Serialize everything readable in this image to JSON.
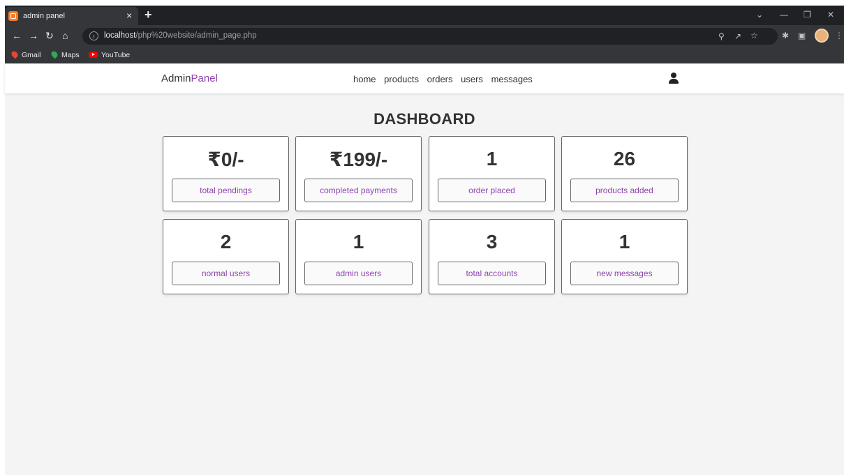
{
  "browser": {
    "tab_title": "admin panel",
    "tab_close": "×",
    "new_tab": "+",
    "url_host": "localhost",
    "url_path": "/php%20website/admin_page.php",
    "bookmarks": [
      "Gmail",
      "Maps",
      "YouTube"
    ]
  },
  "header": {
    "logo_main": "Admin",
    "logo_accent": "Panel",
    "nav": [
      "home",
      "products",
      "orders",
      "users",
      "messages"
    ],
    "user_icon": "user-icon"
  },
  "dashboard": {
    "title": "DASHBOARD",
    "cards": [
      {
        "value": "₹0/-",
        "label": "total pendings"
      },
      {
        "value": "₹199/-",
        "label": "completed payments"
      },
      {
        "value": "1",
        "label": "order placed"
      },
      {
        "value": "26",
        "label": "products added"
      },
      {
        "value": "2",
        "label": "normal users"
      },
      {
        "value": "1",
        "label": "admin users"
      },
      {
        "value": "3",
        "label": "total accounts"
      },
      {
        "value": "1",
        "label": "new messages"
      }
    ]
  },
  "colors": {
    "accent": "#8e44ad",
    "page_bg": "#f4f4f4",
    "chrome_bg": "#202124"
  }
}
